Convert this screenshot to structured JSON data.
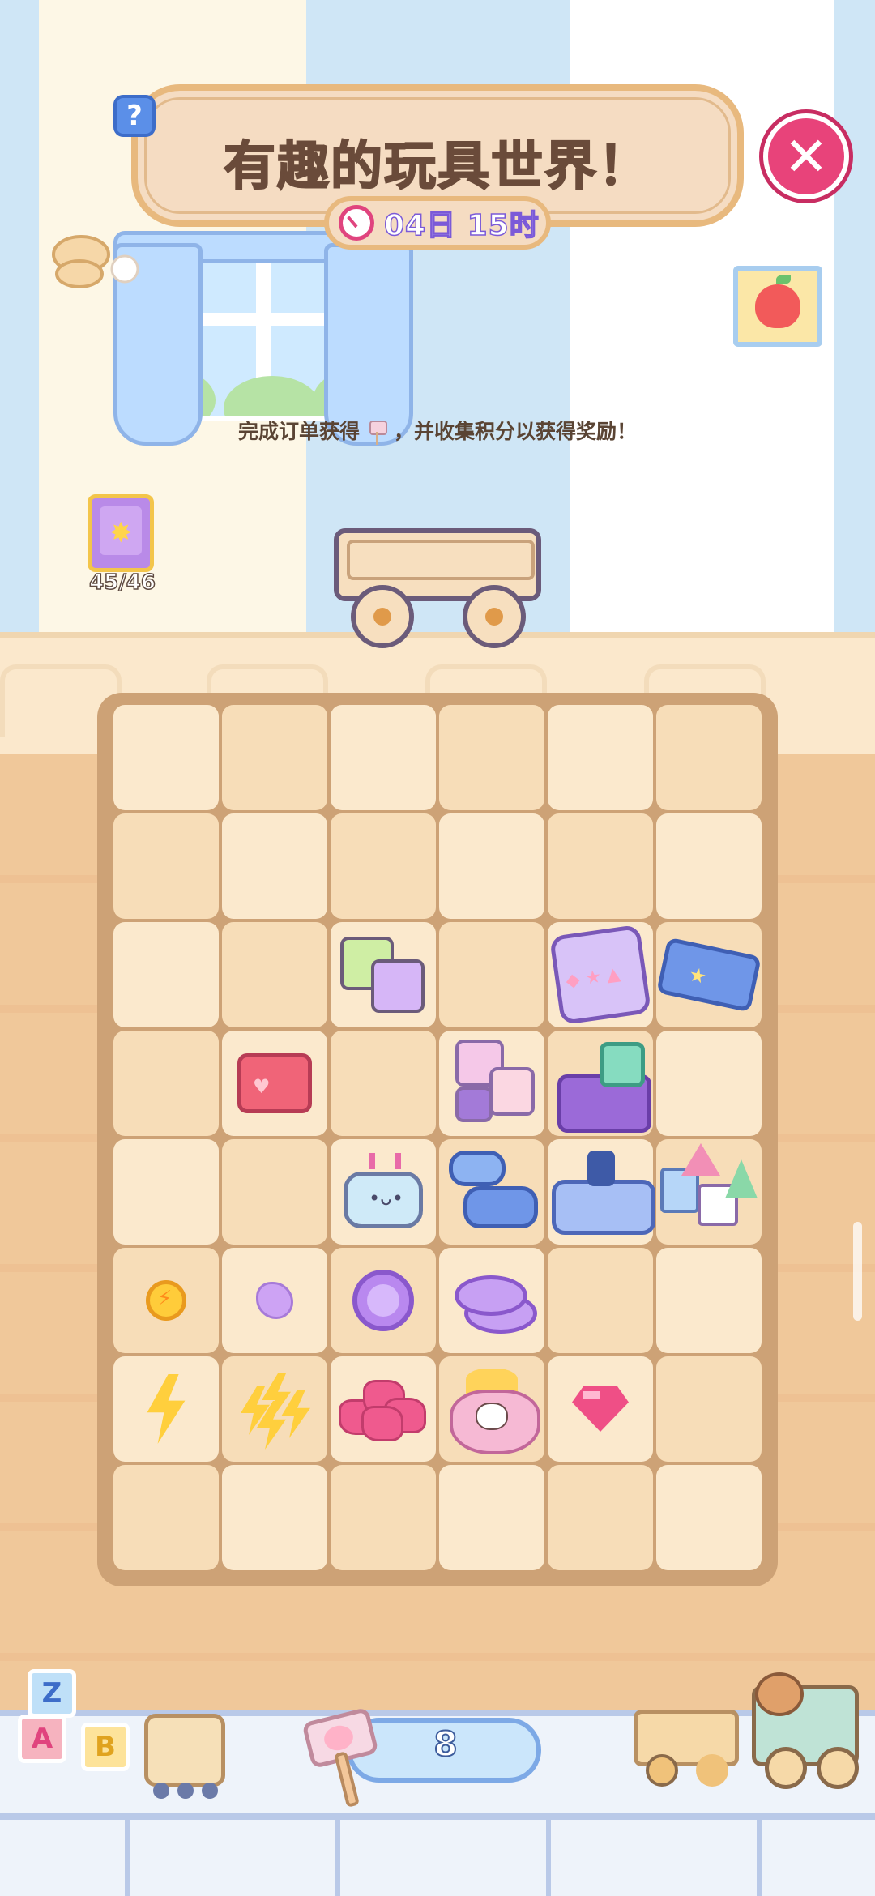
{
  "event": {
    "title": "有趣的玩具世界！",
    "timer": "04日 15时",
    "hint_before": "完成订单获得",
    "hint_after": "，并收集积分以获得奖励！"
  },
  "buttons": {
    "help_label": "?",
    "close_label": "✕"
  },
  "album": {
    "progress": "45/46"
  },
  "hammer": {
    "count": "8"
  },
  "board": {
    "columns": 6,
    "rows": 8,
    "cells": [
      [
        "empty",
        "empty",
        "empty",
        "empty",
        "empty",
        "empty"
      ],
      [
        "empty",
        "empty",
        "empty",
        "empty",
        "empty",
        "empty"
      ],
      [
        "empty",
        "empty",
        "rubiks-cubes",
        "empty",
        "shape-sorter",
        "blue-lego-brick"
      ],
      [
        "empty",
        "red-lego-brick",
        "empty",
        "pink-cubes",
        "purple-lego-bricks",
        "empty"
      ],
      [
        "empty",
        "empty",
        "robot-head",
        "toy-cars",
        "toy-train",
        "block-castle"
      ],
      [
        "energy-coin",
        "purple-pebble",
        "purple-token",
        "purple-token-stack",
        "empty",
        "empty"
      ],
      [
        "lightning-bolt",
        "lightning-bolt-bundle",
        "pink-gem-pile",
        "hello-kitty-purse",
        "pink-gem",
        "empty"
      ],
      [
        "empty",
        "empty",
        "empty",
        "empty",
        "empty",
        "empty"
      ]
    ]
  },
  "colors": {
    "accent_pink": "#e8437a",
    "banner_bg": "#f5dcc2",
    "board_bg": "#cda276",
    "cell_bg": "#fbe9cd"
  },
  "icons": {
    "close": "close-icon",
    "help": "help-icon",
    "timer": "clock-icon",
    "hammer": "hammer-icon",
    "album": "album-icon",
    "picture": "apple-picture-icon"
  }
}
